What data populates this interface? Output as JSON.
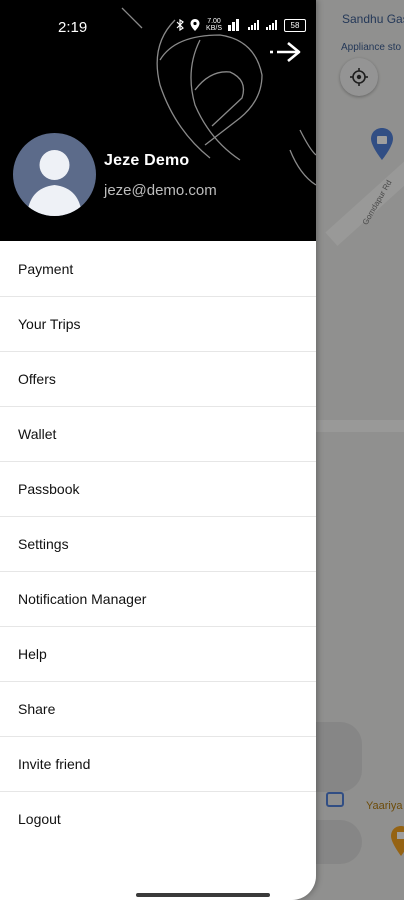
{
  "status_bar": {
    "time": "2:19",
    "icons": [
      "bluetooth-icon",
      "location-icon",
      "data-speed-icon",
      "wifi-icon",
      "signal-icon",
      "signal-icon",
      "battery-icon"
    ],
    "data_speed": "7.00\nKB/S",
    "battery": "58"
  },
  "header": {
    "close_icon": "arrow-right-icon",
    "user": {
      "name": "Jeze  Demo",
      "email": "jeze@demo.com"
    }
  },
  "menu": {
    "items": [
      {
        "label": "Payment"
      },
      {
        "label": "Your Trips"
      },
      {
        "label": "Offers"
      },
      {
        "label": "Wallet"
      },
      {
        "label": "Passbook"
      },
      {
        "label": "Settings"
      },
      {
        "label": "Notification Manager"
      },
      {
        "label": "Help"
      },
      {
        "label": "Share"
      },
      {
        "label": "Invite friend"
      },
      {
        "label": "Logout"
      }
    ]
  },
  "map": {
    "labels": [
      "Sandhu Gas",
      "Appliance sto",
      "Gomdapur Rd",
      "Yaariya"
    ]
  },
  "colors": {
    "header_bg": "#000000",
    "drawer_bg": "#ffffff",
    "avatar_bg": "#5c6b8a",
    "pin_blue": "#4f7fd6",
    "pin_orange": "#f0a020"
  }
}
